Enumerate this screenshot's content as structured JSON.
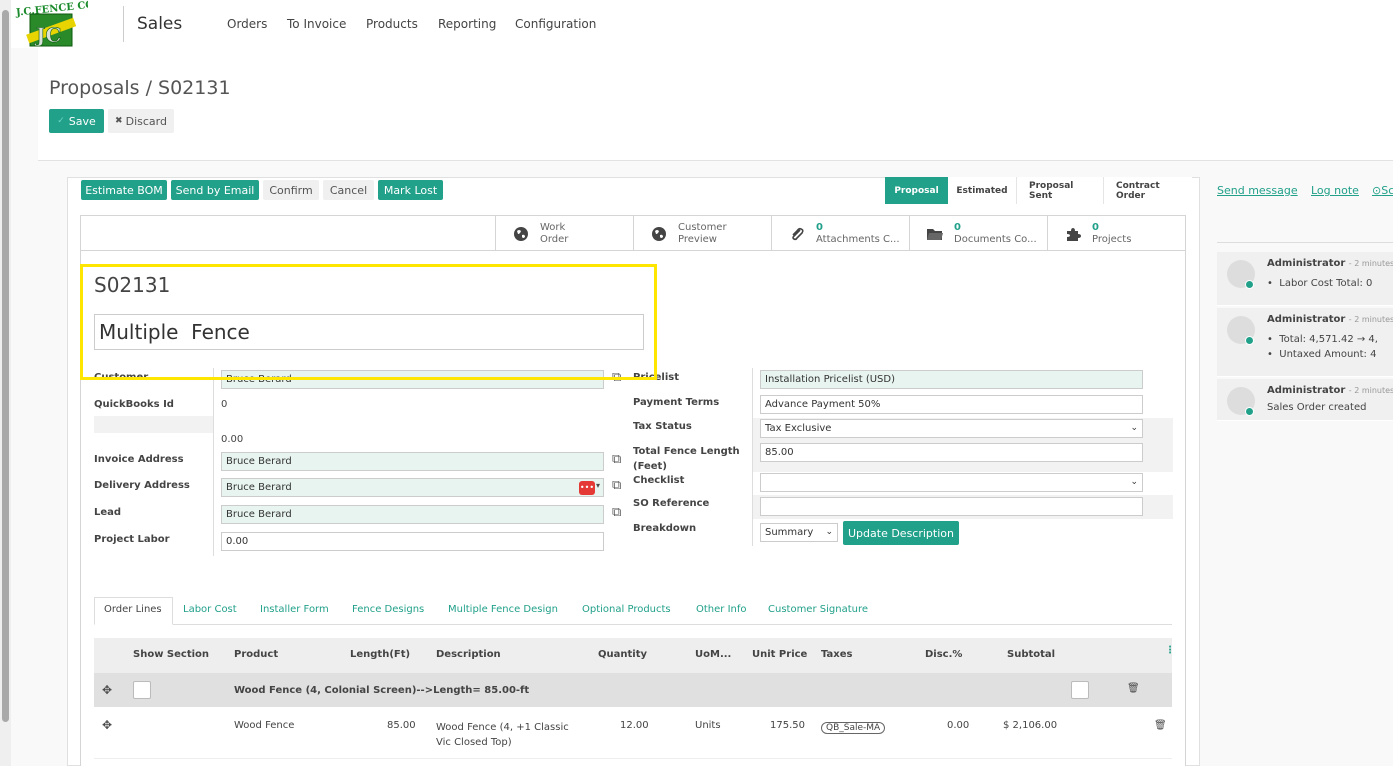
{
  "brand": {
    "logo_text": "J.C. FENCE CO."
  },
  "app": {
    "title": "Sales"
  },
  "menu": [
    "Orders",
    "To Invoice",
    "Products",
    "Reporting",
    "Configuration"
  ],
  "breadcrumb": "Proposals / S02131",
  "cp_buttons": {
    "save": "Save",
    "discard": "Discard"
  },
  "header_buttons": {
    "estimate_bom": "Estimate BOM",
    "send_email": "Send by Email",
    "confirm": "Confirm",
    "cancel": "Cancel",
    "mark_lost": "Mark Lost"
  },
  "stages": [
    {
      "label": "Proposal",
      "active": true
    },
    {
      "label": "Estimated",
      "active": false
    },
    {
      "label": "Proposal Sent",
      "active": false
    },
    {
      "label": "Contract Order",
      "active": false
    }
  ],
  "smart_buttons": [
    {
      "num": "",
      "line1": "Work",
      "line2": "Order",
      "icon": "globe-icon"
    },
    {
      "num": "",
      "line1": "Customer",
      "line2": "Preview",
      "icon": "globe-icon"
    },
    {
      "num": "0",
      "line1": "",
      "line2": "Attachments C...",
      "icon": "paperclip-icon"
    },
    {
      "num": "0",
      "line1": "",
      "line2": "Documents Co...",
      "icon": "folder-icon"
    },
    {
      "num": "0",
      "line1": "",
      "line2": "Projects",
      "icon": "puzzle-icon"
    }
  ],
  "record": {
    "ref": "S02131",
    "name": "Multiple  Fence"
  },
  "left_fields": {
    "customer_label": "Customer",
    "customer_value": "Bruce Berard",
    "qb_label": "QuickBooks Id",
    "qb_value": "0",
    "amount_value": "0.00",
    "invoice_label": "Invoice Address",
    "invoice_value": "Bruce Berard",
    "delivery_label": "Delivery Address",
    "delivery_value": "Bruce Berard",
    "lead_label": "Lead",
    "lead_value": "Bruce Berard",
    "labor_label": "Project Labor",
    "labor_value": "0.00"
  },
  "right_fields": {
    "pricelist_label": "Pricelist",
    "pricelist_value": "Installation Pricelist (USD)",
    "payment_label": "Payment Terms",
    "payment_value": "Advance Payment 50%",
    "tax_label": "Tax Status",
    "tax_value": "Tax Exclusive",
    "fence_length_label_1": "Total Fence Length",
    "fence_length_label_2": "(Feet)",
    "fence_length_value": "85.00",
    "checklist_label": "Checklist",
    "checklist_value": "",
    "soref_label": "SO Reference",
    "soref_value": "",
    "breakdown_label": "Breakdown",
    "breakdown_value": "Summary",
    "update_btn": "Update Description"
  },
  "tabs": [
    "Order Lines",
    "Labor Cost",
    "Installer Form",
    "Fence Designs",
    "Multiple Fence Design",
    "Optional Products",
    "Other Info",
    "Customer Signature"
  ],
  "table": {
    "headers": {
      "show_section": "Show Section",
      "product": "Product",
      "length": "Length(Ft)",
      "description": "Description",
      "quantity": "Quantity",
      "uom": "UoM...",
      "unit_price": "Unit Price",
      "taxes": "Taxes",
      "disc": "Disc.%",
      "subtotal": "Subtotal"
    },
    "section_label": "Wood Fence (4, Colonial Screen)-->Length= 85.00-ft",
    "row": {
      "product": "Wood Fence",
      "length": "85.00",
      "desc_1": "Wood Fence (4, +1 Classic",
      "desc_2": "Vic Closed Top)",
      "quantity": "12.00",
      "uom": "Units",
      "unit_price": "175.50",
      "tax": "QB_Sale-MA",
      "disc": "0.00",
      "subtotal": "$ 2,106.00"
    }
  },
  "chatter": {
    "send_message": "Send message",
    "log_note": "Log note",
    "schedule": "Sc",
    "messages": [
      {
        "author": "Administrator",
        "time": "- 2 minutes",
        "lines": [
          "Labor Cost Total: 0"
        ]
      },
      {
        "author": "Administrator",
        "time": "- 2 minutes",
        "lines": [
          "Total: 4,571.42 → 4,",
          "Untaxed Amount: 4"
        ]
      },
      {
        "author": "Administrator",
        "time": "- 2 minutes",
        "lines": [
          "Sales Order created"
        ]
      }
    ]
  },
  "colors": {
    "primary": "#21a08a",
    "highlight": "#ffe600"
  }
}
